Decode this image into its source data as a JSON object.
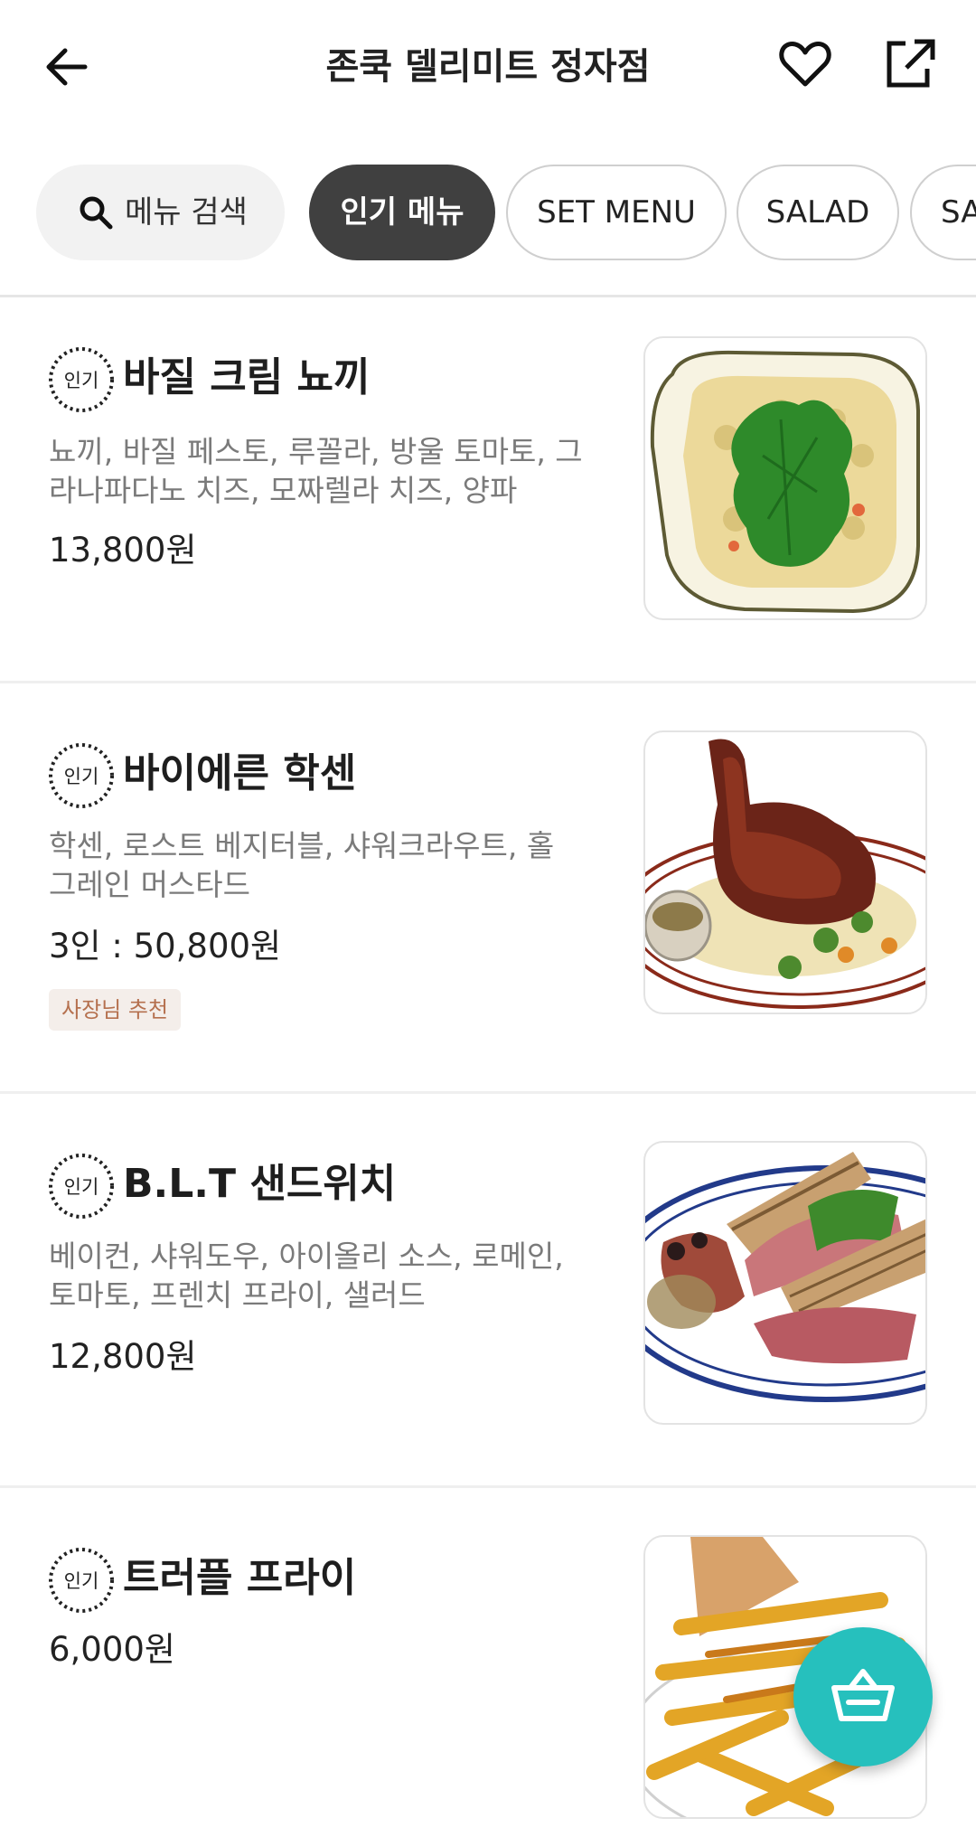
{
  "header": {
    "title": "존쿡 델리미트 정자점"
  },
  "categories": {
    "search_label": "메뉴 검색",
    "chips": [
      "인기 메뉴",
      "SET MENU",
      "SALAD",
      "SA"
    ]
  },
  "menu": [
    {
      "badge": "인기",
      "name": "바질 크림 뇨끼",
      "desc": "뇨끼, 바질 페스토, 루꼴라, 방울 토마토, 그라나파다노 치즈, 모짜렐라 치즈, 양파",
      "price": "13,800원"
    },
    {
      "badge": "인기",
      "name": "바이에른 학센",
      "desc": "학센, 로스트 베지터블, 샤워크라우트, 홀그레인 머스타드",
      "price": "3인 : 50,800원",
      "tag": "사장님 추천"
    },
    {
      "badge": "인기",
      "name": "B.L.T 샌드위치",
      "desc": "베이컨, 샤워도우, 아이올리 소스, 로메인, 토마토, 프렌치 프라이, 샐러드",
      "price": "12,800원"
    },
    {
      "badge": "인기",
      "name": "트러플 프라이",
      "price": "6,000원"
    }
  ],
  "colors": {
    "accent": "#26c0bd",
    "active_chip": "#404040",
    "tag_text": "#b5704e",
    "tag_bg": "#f4eeea"
  },
  "icons": [
    "back-arrow-icon",
    "heart-icon",
    "share-icon",
    "search-icon",
    "popular-badge-icon",
    "cart-basket-icon"
  ]
}
